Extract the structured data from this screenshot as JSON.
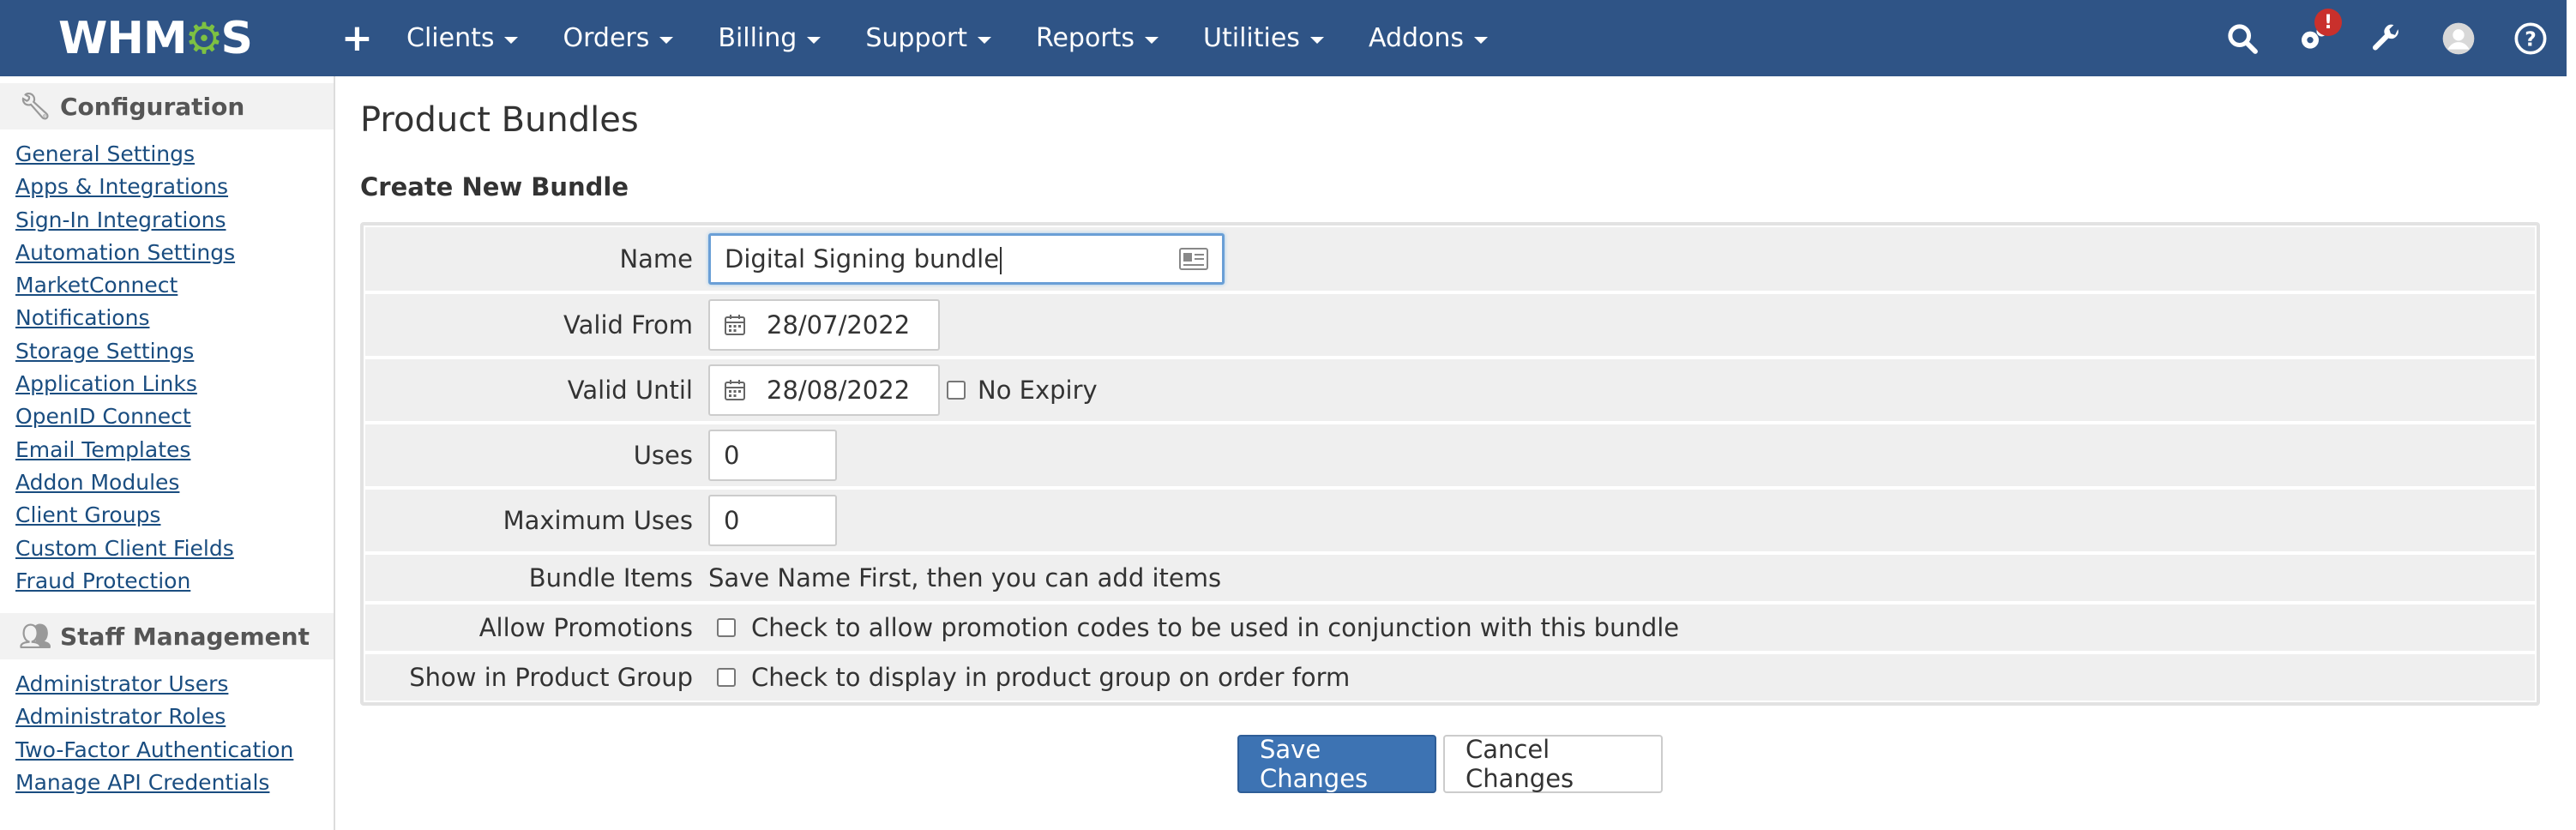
{
  "navbar": {
    "logo_text": "WHM",
    "logo_text_end": "S",
    "menu": [
      "Clients",
      "Orders",
      "Billing",
      "Support",
      "Reports",
      "Utilities",
      "Addons"
    ],
    "badge": "!"
  },
  "sidebar": {
    "config_title": "Configuration",
    "config_links": [
      "General Settings",
      "Apps & Integrations",
      "Sign-In Integrations",
      "Automation Settings",
      "MarketConnect",
      "Notifications",
      "Storage Settings",
      "Application Links",
      "OpenID Connect",
      "Email Templates",
      "Addon Modules",
      "Client Groups",
      "Custom Client Fields",
      "Fraud Protection"
    ],
    "staff_title": "Staff Management",
    "staff_links": [
      "Administrator Users",
      "Administrator Roles",
      "Two-Factor Authentication",
      "Manage API Credentials"
    ]
  },
  "main": {
    "page_title": "Product Bundles",
    "section_title": "Create New Bundle",
    "form": {
      "name_label": "Name",
      "name_value": "Digital Signing bundle",
      "valid_from_label": "Valid From",
      "valid_from_value": "28/07/2022",
      "valid_until_label": "Valid Until",
      "valid_until_value": "28/08/2022",
      "no_expiry_label": "No Expiry",
      "uses_label": "Uses",
      "uses_value": "0",
      "max_uses_label": "Maximum Uses",
      "max_uses_value": "0",
      "bundle_items_label": "Bundle Items",
      "bundle_items_text": "Save Name First, then you can add items",
      "allow_promotions_label": "Allow Promotions",
      "allow_promotions_text": "Check to allow promotion codes to be used in conjunction with this bundle",
      "show_in_group_label": "Show in Product Group",
      "show_in_group_text": "Check to display in product group on order form"
    },
    "buttons": {
      "save": "Save Changes",
      "cancel": "Cancel Changes"
    }
  },
  "colors": {
    "navbar": "#2f5486",
    "primary_button": "#3d73b3",
    "link": "#1a4d80",
    "badge": "#c9302c"
  }
}
